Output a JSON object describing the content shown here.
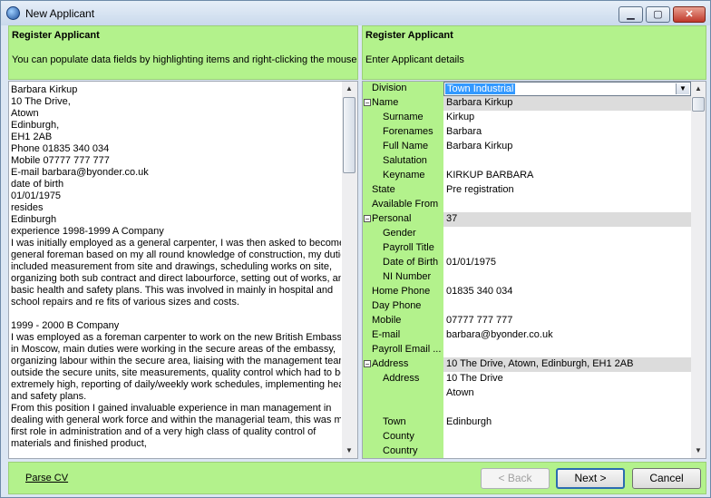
{
  "window": {
    "title": "New Applicant",
    "minimize_glyph": "▁",
    "maximize_glyph": "▢",
    "close_glyph": "✕"
  },
  "left_header": {
    "title": "Register Applicant",
    "subtitle": "You can populate data fields by highlighting items and right-clicking the mouse"
  },
  "right_header": {
    "title": "Register Applicant",
    "subtitle": "Enter Applicant details"
  },
  "cv_lines": [
    "Barbara Kirkup",
    "10 The Drive,",
    "Atown",
    "Edinburgh,",
    "EH1 2AB",
    "Phone 01835 340 034",
    "Mobile 07777 777 777",
    "E-mail barbara@byonder.co.uk",
    "date of birth",
    "01/01/1975",
    "resides",
    "Edinburgh",
    "experience 1998-1999 A Company",
    "I was initially employed as a general carpenter, I was then asked to become",
    "general foreman based on my all round knowledge of construction, my duties",
    "included measurement from site and drawings, scheduling works on site,",
    "organizing both sub contract and direct labourforce, setting out of works, and",
    "basic health and safety plans. This was involved in mainly in hospital and",
    "school repairs and re fits of various sizes and costs.",
    "",
    "1999 - 2000 B Company",
    "I was employed as a foreman carpenter to work on the new British Embassy",
    "in Moscow, main duties were working in the secure areas of the embassy,",
    "organizing labour within the secure area, liaising with the management team",
    "outside the secure units, site measurements, quality control which had to be",
    "extremely high, reporting of daily/weekly work schedules, implementing heath",
    "and safety plans.",
    "From this position I gained invaluable experience in man management in",
    "dealing with general work force and within the managerial team, this was my",
    "first role in administration and of a very high class of quality control of",
    "materials and finished product,"
  ],
  "division": {
    "label": "Division",
    "value": "Town Industrial"
  },
  "properties": [
    {
      "label": "Name",
      "value": "Barbara Kirkup",
      "category": true,
      "indent": 0
    },
    {
      "label": "Surname",
      "value": "Kirkup",
      "indent": 2
    },
    {
      "label": "Forenames",
      "value": "Barbara",
      "indent": 2
    },
    {
      "label": "Full Name",
      "value": "Barbara Kirkup",
      "indent": 2
    },
    {
      "label": "Salutation",
      "value": "",
      "indent": 2
    },
    {
      "label": "Keyname",
      "value": "KIRKUP BARBARA",
      "indent": 2
    },
    {
      "label": "State",
      "value": "Pre registration",
      "indent": 1
    },
    {
      "label": "Available From",
      "value": "",
      "indent": 1
    },
    {
      "label": "Personal",
      "value": "37",
      "category": true,
      "indent": 0
    },
    {
      "label": "Gender",
      "value": "",
      "indent": 2
    },
    {
      "label": "Payroll Title",
      "value": "",
      "indent": 2
    },
    {
      "label": "Date of Birth",
      "value": "01/01/1975",
      "indent": 2
    },
    {
      "label": "NI Number",
      "value": "",
      "indent": 2
    },
    {
      "label": "Home Phone",
      "value": "01835 340 034",
      "indent": 1
    },
    {
      "label": "Day Phone",
      "value": "",
      "indent": 1
    },
    {
      "label": "Mobile",
      "value": "07777 777 777",
      "indent": 1
    },
    {
      "label": "E-mail",
      "value": "barbara@byonder.co.uk",
      "indent": 1
    },
    {
      "label": "Payroll Email ...",
      "value": "",
      "indent": 1
    },
    {
      "label": "Address",
      "value": "10 The Drive, Atown, Edinburgh, EH1 2AB",
      "category": true,
      "indent": 0
    },
    {
      "label": "Address",
      "value": "10 The Drive",
      "indent": 2
    },
    {
      "label": "",
      "value": "Atown",
      "indent": 2
    },
    {
      "label": "",
      "value": "",
      "indent": 2
    },
    {
      "label": "Town",
      "value": "Edinburgh",
      "indent": 2
    },
    {
      "label": "County",
      "value": "",
      "indent": 2
    },
    {
      "label": "Country",
      "value": "",
      "indent": 2
    }
  ],
  "footer": {
    "parse_cv": "Parse CV",
    "back": "< Back",
    "next": "Next >",
    "cancel": "Cancel"
  }
}
